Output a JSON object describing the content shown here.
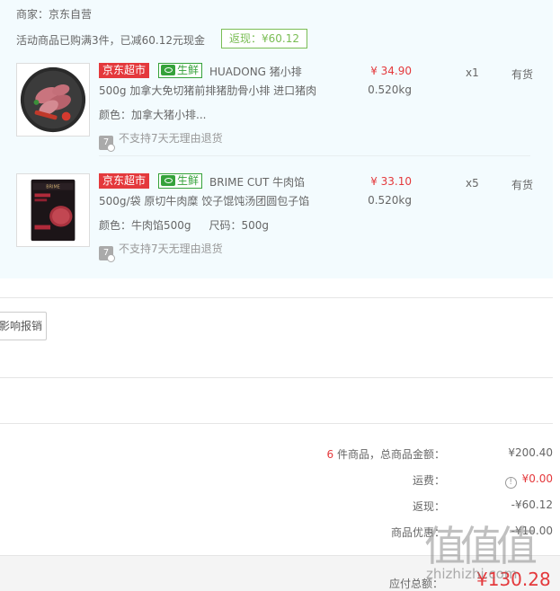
{
  "order": {
    "seller": "商家：京东自营",
    "promo": "活动商品已购满3件，已减60.12元现金",
    "rebate_tag": "返现：¥60.12"
  },
  "items": [
    {
      "badge_jd": "京东超市",
      "badge_fresh": "生鲜",
      "title_line1": "HUADONG 猪小排",
      "title_line2": "500g 加拿大免切猪前排猪肋骨小排 进口猪肉",
      "attrs": "颜色：加拿大猪小排...",
      "attr_size": "",
      "no_return": "不支持7天无理由退货",
      "price": "¥ 34.90",
      "weight": "0.520kg",
      "qty": "x1",
      "stock": "有货"
    },
    {
      "badge_jd": "京东超市",
      "badge_fresh": "生鲜",
      "title_line1": "BRIME CUT 牛肉馅",
      "title_line2": "500g/袋 原切牛肉糜 饺子馄饨汤团圆包子馅",
      "attrs": "颜色：牛肉馅500g",
      "attr_size": "尺码：500g",
      "no_return": "不支持7天无理由退货",
      "price": "¥ 33.10",
      "weight": "0.520kg",
      "qty": "x5",
      "stock": "有货"
    }
  ],
  "expense_button": "影响报销",
  "summary": {
    "count": "6",
    "goods_label": " 件商品，总商品金额：",
    "goods_value": "¥200.40",
    "freight_label": "运费：",
    "freight_value": "¥0.00",
    "rebate_label": "返现：",
    "rebate_value": "-¥60.12",
    "discount_label": "商品优惠：",
    "discount_value": "-¥10.00",
    "pay_label": "应付总额：",
    "pay_value": "¥130.28"
  },
  "watermark": {
    "glyphs": "值值值",
    "url": "zhizhizhi.com"
  },
  "colors": {
    "price_red": "#e4393c",
    "fresh_green": "#35a23a",
    "rebate_green": "#7abd54",
    "panel_bg": "#f3fbfe"
  },
  "icons": {
    "fresh": "fish-icon",
    "no_return": "seven-day-return-icon",
    "freight_info": "info-icon"
  }
}
